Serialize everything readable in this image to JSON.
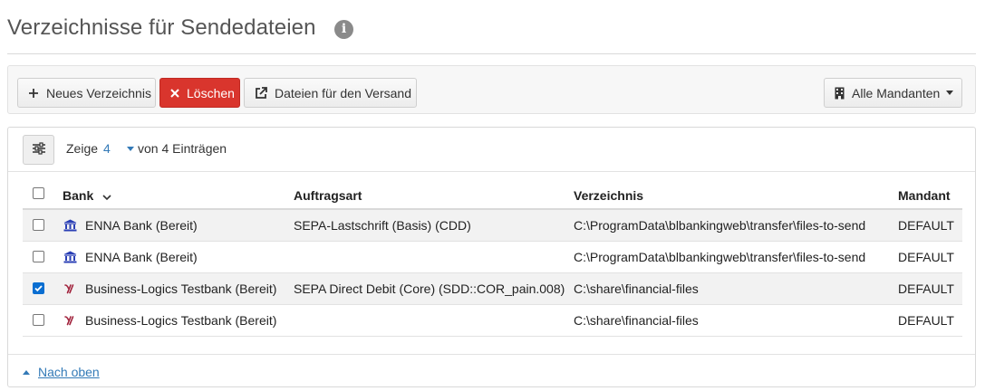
{
  "header": {
    "title": "Verzeichnisse für Sendedateien",
    "info_icon": "i"
  },
  "toolbar": {
    "new_label": "Neues Verzeichnis",
    "delete_label": "Löschen",
    "files_label": "Dateien für den Versand",
    "mandant_label": "Alle Mandanten"
  },
  "list": {
    "show_label": "Zeige",
    "show_count": "4",
    "of_label": "von 4 Einträgen"
  },
  "table": {
    "columns": {
      "bank": "Bank",
      "auftragsart": "Auftragsart",
      "verzeichnis": "Verzeichnis",
      "mandant": "Mandant"
    },
    "rows": [
      {
        "bank": "ENNA Bank (Bereit)",
        "icon": "bank-icon",
        "auftragsart": "SEPA-Lastschrift (Basis) (CDD)",
        "verzeichnis": "C:\\ProgramData\\blbankingweb\\transfer\\files-to-send",
        "mandant": "DEFAULT",
        "checked": false
      },
      {
        "bank": "ENNA Bank (Bereit)",
        "icon": "bank-icon",
        "auftragsart": "",
        "verzeichnis": "C:\\ProgramData\\blbankingweb\\transfer\\files-to-send",
        "mandant": "DEFAULT",
        "checked": false
      },
      {
        "bank": "Business-Logics Testbank (Bereit)",
        "icon": "bl-logo-icon",
        "auftragsart": "SEPA Direct Debit (Core) (SDD::COR_pain.008)",
        "verzeichnis": "C:\\share\\financial-files",
        "mandant": "DEFAULT",
        "checked": true
      },
      {
        "bank": "Business-Logics Testbank (Bereit)",
        "icon": "bl-logo-icon",
        "auftragsart": "",
        "verzeichnis": "C:\\share\\financial-files",
        "mandant": "DEFAULT",
        "checked": false
      }
    ]
  },
  "footer": {
    "back_to_top": "Nach oben"
  },
  "colors": {
    "accent": "#337ab7",
    "danger": "#d9352d",
    "bank_icon": "#2a3fb5",
    "bl_logo": "#a0203a"
  }
}
